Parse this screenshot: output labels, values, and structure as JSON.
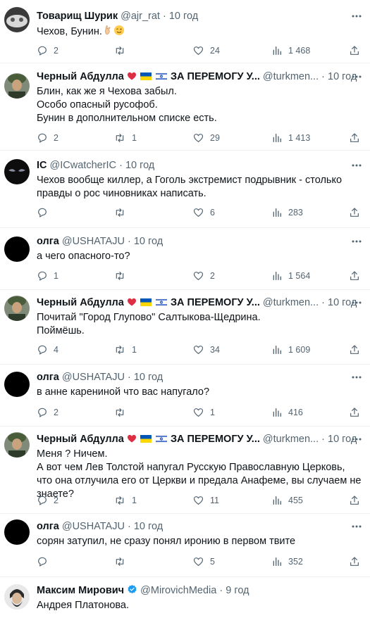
{
  "tweets": [
    {
      "name": "Товарищ Шурик",
      "handle": "@ajr_rat",
      "sep": "·",
      "time": "10 год",
      "text": "Чехов, Бунин.",
      "emoji": [
        "pinched-hand",
        "winking-face"
      ],
      "reply": "2",
      "retweet": "",
      "like": "24",
      "views": "1 468"
    },
    {
      "name": "Черный Абдулла",
      "badge_text": "ЗА ПЕРЕМОГУ У...",
      "handle": "@turkmen...",
      "sep": "·",
      "time": "10 год",
      "text": "Блин, как же я Чехова забыл.\nОсобо опасный русофоб.\nБунин в дополнительном списке есть.",
      "reply": "2",
      "retweet": "1",
      "like": "29",
      "views": "1 413"
    },
    {
      "name": "IC",
      "handle": "@ICwatcherIC",
      "sep": "·",
      "time": "10 год",
      "text": "Чехов вообще киллер, а Гоголь экстремист подрывник - столько правды о рос чиновниках написать.",
      "reply": "",
      "retweet": "",
      "like": "6",
      "views": "283"
    },
    {
      "name": "олга",
      "handle": "@USHATAJU",
      "sep": "·",
      "time": "10 год",
      "text": "а чего опасного-то?",
      "reply": "1",
      "retweet": "",
      "like": "2",
      "views": "1 564"
    },
    {
      "name": "Черный Абдулла",
      "badge_text": "ЗА ПЕРЕМОГУ У...",
      "handle": "@turkmen...",
      "sep": "·",
      "time": "10 год",
      "text": "Почитай \"Город Глупово\" Салтыкова-Щедрина.\nПоймёшь.",
      "reply": "4",
      "retweet": "1",
      "like": "34",
      "views": "1 609"
    },
    {
      "name": "олга",
      "handle": "@USHATAJU",
      "sep": "·",
      "time": "10 год",
      "text": "в анне карениной что вас напугало?",
      "reply": "2",
      "retweet": "",
      "like": "1",
      "views": "416"
    },
    {
      "name": "Черный Абдулла",
      "badge_text": "ЗА ПЕРЕМОГУ У...",
      "handle": "@turkmen...",
      "sep": "·",
      "time": "10 год",
      "text": "Меня ? Ничем.\nА вот чем Лев Толстой напугал Русскую Православную Церковь, что она отлучила его от Церкви и предала Анафеме, вы случаем не знаете?",
      "reply": "2",
      "retweet": "1",
      "like": "11",
      "views": "455"
    },
    {
      "name": "олга",
      "handle": "@USHATAJU",
      "sep": "·",
      "time": "10 год",
      "text": "сорян затупил, не сразу понял иронию в первом твите",
      "reply": "",
      "retweet": "",
      "like": "5",
      "views": "352"
    },
    {
      "name": "Максим Мирович",
      "verified": true,
      "handle": "@MirovichMedia",
      "sep": "·",
      "time": "9 год",
      "text": "Андрея Платонова."
    }
  ],
  "colors": {
    "text": "#0f1419",
    "secondary": "#536471",
    "verified": "#1d9bf0",
    "heart": "#f91880",
    "divider": "#eff3f4"
  }
}
